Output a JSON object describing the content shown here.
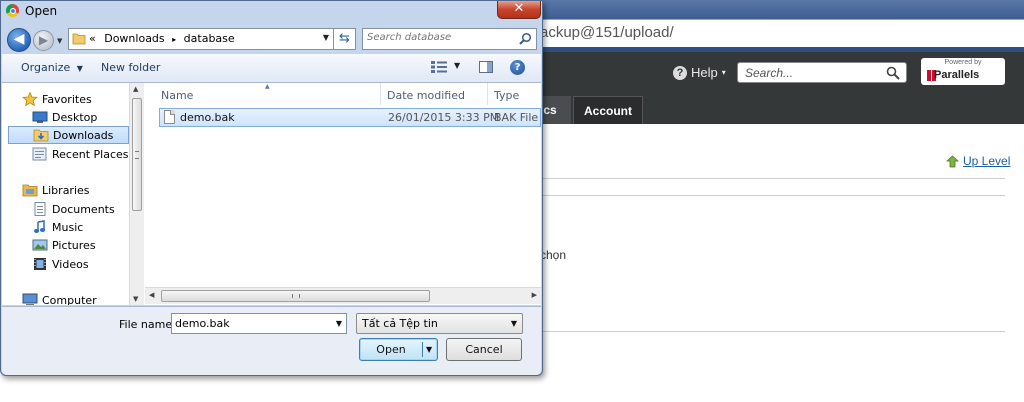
{
  "background": {
    "address_text": "ackup@151/upload/",
    "help_label": "Help",
    "help_icon": "?",
    "search_placeholder": "Search...",
    "parallels_powered_by": "Powered by",
    "parallels_name": "Parallels",
    "tab_partial": "ics",
    "tab_account": "Account",
    "up_level": "Up Level",
    "partial_text": "chọn"
  },
  "dialog": {
    "title": "Open",
    "close_glyph": "✕",
    "breadcrumb": {
      "prefix": "«",
      "items": [
        "Downloads",
        "database"
      ],
      "separator": "▸"
    },
    "search_placeholder": "Search database",
    "toolbar": {
      "organize": "Organize",
      "new_folder": "New folder",
      "help": "?"
    },
    "nav": [
      {
        "label": "Favorites",
        "icon": "star-icon",
        "indent": 0,
        "selected": false
      },
      {
        "label": "Desktop",
        "icon": "desktop-icon",
        "indent": 1,
        "selected": false
      },
      {
        "label": "Downloads",
        "icon": "downloads-folder-icon",
        "indent": 1,
        "selected": true
      },
      {
        "label": "Recent Places",
        "icon": "recent-places-icon",
        "indent": 1,
        "selected": false
      },
      {
        "label": "Libraries",
        "icon": "libraries-icon",
        "indent": 0,
        "selected": false
      },
      {
        "label": "Documents",
        "icon": "documents-icon",
        "indent": 1,
        "selected": false
      },
      {
        "label": "Music",
        "icon": "music-icon",
        "indent": 1,
        "selected": false
      },
      {
        "label": "Pictures",
        "icon": "pictures-icon",
        "indent": 1,
        "selected": false
      },
      {
        "label": "Videos",
        "icon": "videos-icon",
        "indent": 1,
        "selected": false
      },
      {
        "label": "Computer",
        "icon": "computer-icon",
        "indent": 0,
        "selected": false
      }
    ],
    "columns": [
      "Name",
      "Date modified",
      "Type"
    ],
    "files": [
      {
        "name": "demo.bak",
        "date": "26/01/2015 3:33 PM",
        "type": "BAK File"
      }
    ],
    "file_name_label": "File name:",
    "file_name_value": "demo.bak",
    "file_type": "Tất cả Tệp tin",
    "open_button": "Open",
    "cancel_button": "Cancel"
  }
}
